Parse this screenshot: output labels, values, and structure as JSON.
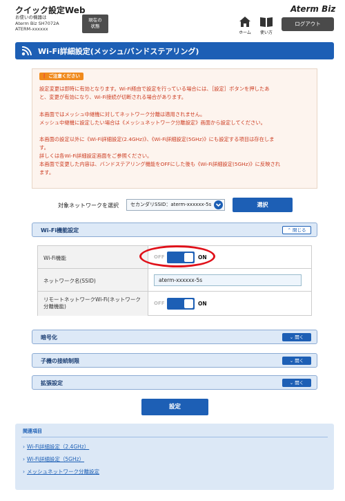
{
  "header": {
    "app_title": "クイック設定Web",
    "device_info": [
      "お使いの機器は",
      "Aterm Biz SH7072A",
      "ATERM-xxxxxx"
    ],
    "status_button": [
      "現在の",
      "状態"
    ],
    "home_label": "ホーム",
    "manual_label": "使い方",
    "logo": "Aterm Biz",
    "logout_label": "ログアウト"
  },
  "page": {
    "title": "Wi-Fi詳細設定(メッシュ/バンドステアリング)"
  },
  "notice": {
    "badge": "ご注意ください",
    "lines": [
      "設定変更は即時に有効となります。Wi-Fi経由で設定を行っている場合には、［設定］ボタンを押したあ",
      "と、変更が有効になり、Wi-Fi接続が切断される場合があります。",
      "本画面ではメッシュ中継機に対してネットワーク分離は適用されません。",
      "メッシュ中継機に設定したい場合は《メッシュネットワーク分離設定》画面から設定してください。",
      "本画面の設定以外に《Wi-Fi詳細設定(2.4GHz)》、《Wi-Fi詳細設定(5GHz)》にも設定する項目は存在しま",
      "す。",
      "詳しくは各Wi-Fi詳細設定画面をご参照ください。",
      "本画面で変更した内容は、バンドステアリング機能をOFFにした後も《Wi-Fi詳細設定(5GHz)》に反映され",
      "ます。"
    ]
  },
  "network_select": {
    "label": "対象ネットワークを選択",
    "value": "セカンダリSSID：aterm-xxxxxx-5s",
    "button": "選択"
  },
  "wifi_section": {
    "title": "Wi-Fi機能設定",
    "toggle": "閉じる",
    "rows": [
      {
        "label": "Wi-Fi機能",
        "off": "OFF",
        "on": "ON",
        "state": "on"
      },
      {
        "label": "ネットワーク名(SSID)",
        "value": "aterm-xxxxxx-5s"
      },
      {
        "label": "リモートネットワークWi-Fi(ネットワーク分離機能)",
        "off": "OFF",
        "on": "ON",
        "state": "on"
      }
    ]
  },
  "collapsed_sections": [
    {
      "title": "暗号化",
      "toggle": "開く"
    },
    {
      "title": "子機の接続制限",
      "toggle": "開く"
    },
    {
      "title": "拡張設定",
      "toggle": "開く"
    }
  ],
  "save_label": "設定",
  "related": {
    "title": "関連項目",
    "links": [
      "Wi-Fi詳細設定（2.4GHz）",
      "Wi-Fi詳細設定（5GHz）",
      "メッシュネットワーク分離設定"
    ]
  },
  "colors": {
    "accent": "#1d5fb5",
    "warning_text": "#cc3b20",
    "highlight": "#e0111a"
  }
}
